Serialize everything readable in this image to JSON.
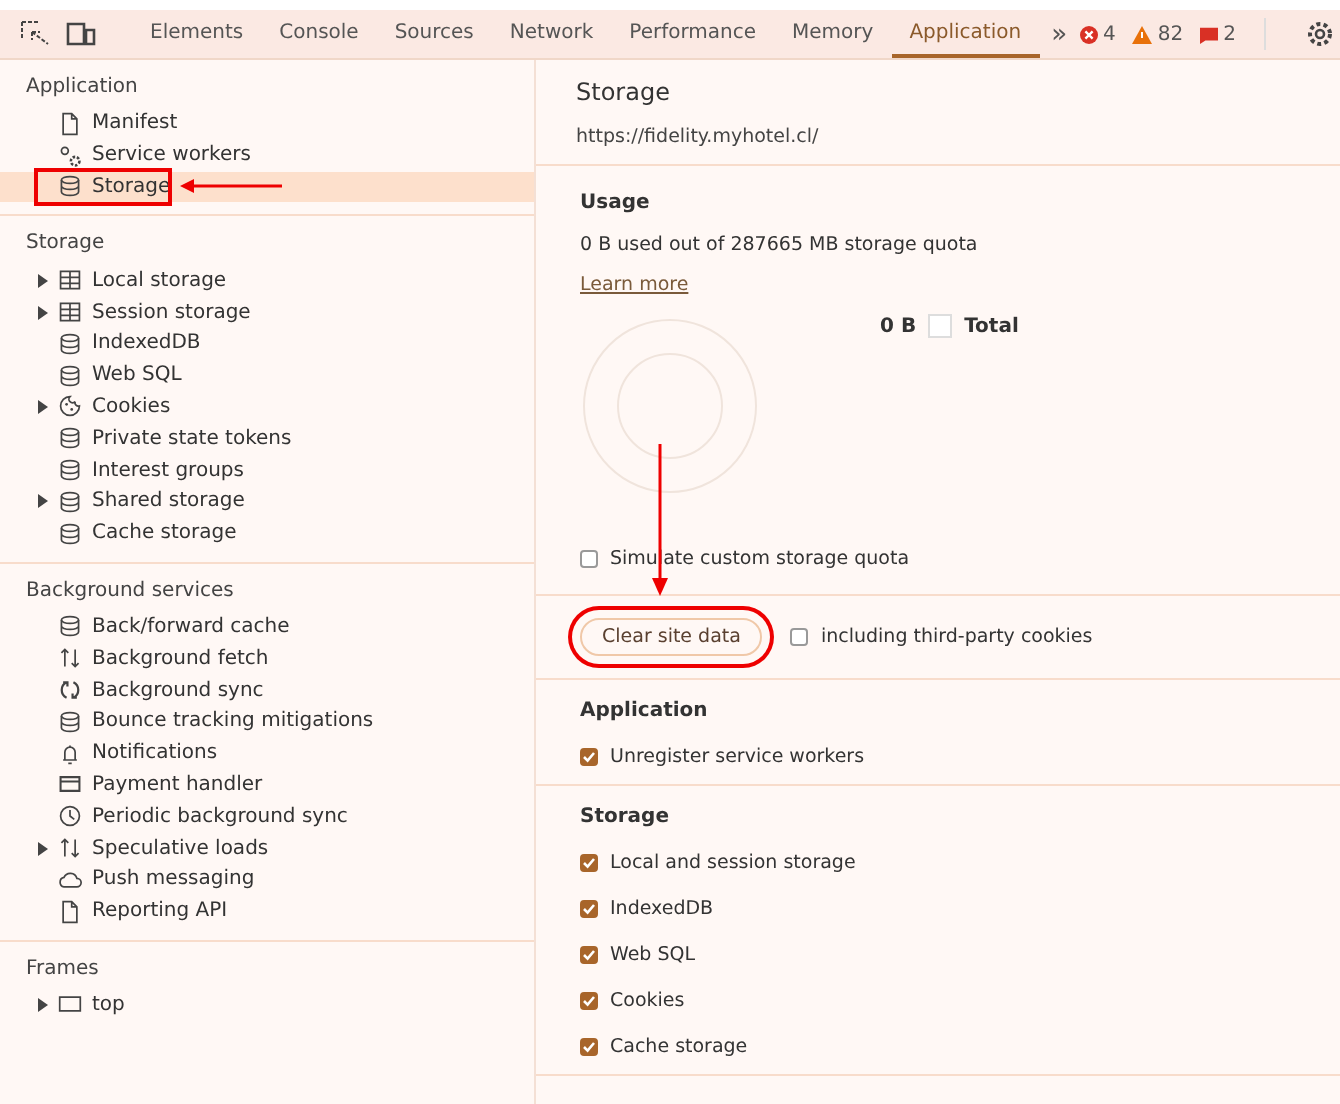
{
  "toolbar": {
    "tabs": [
      {
        "label": "Elements",
        "selected": false
      },
      {
        "label": "Console",
        "selected": false
      },
      {
        "label": "Sources",
        "selected": false
      },
      {
        "label": "Network",
        "selected": false
      },
      {
        "label": "Performance",
        "selected": false
      },
      {
        "label": "Memory",
        "selected": false
      },
      {
        "label": "Application",
        "selected": true
      }
    ],
    "more": "»",
    "counters": [
      {
        "kind": "error",
        "count": "4"
      },
      {
        "kind": "warning",
        "count": "82"
      },
      {
        "kind": "issue",
        "count": "2"
      }
    ]
  },
  "sidebar": {
    "sections": [
      {
        "title": "Application",
        "items": [
          {
            "label": "Manifest",
            "kind": "page",
            "selected": false,
            "highlighted": false
          },
          {
            "label": "Service workers",
            "kind": "gears",
            "selected": false,
            "highlighted": false
          },
          {
            "label": "Storage",
            "kind": "database",
            "selected": true,
            "highlighted": true
          }
        ]
      },
      {
        "title": "Storage",
        "items": [
          {
            "label": "Local storage",
            "kind": "table",
            "expanded": false,
            "selected": false,
            "highlighted": false
          },
          {
            "label": "Session storage",
            "kind": "table",
            "expanded": false,
            "selected": false,
            "highlighted": false
          },
          {
            "label": "IndexedDB",
            "kind": "database",
            "selected": false,
            "highlighted": false
          },
          {
            "label": "Web SQL",
            "kind": "database",
            "selected": false,
            "highlighted": false
          },
          {
            "label": "Cookies",
            "kind": "cookie",
            "expanded": false,
            "selected": false,
            "highlighted": false
          },
          {
            "label": "Private state tokens",
            "kind": "database",
            "selected": false,
            "highlighted": false
          },
          {
            "label": "Interest groups",
            "kind": "database",
            "selected": false,
            "highlighted": false
          },
          {
            "label": "Shared storage",
            "kind": "database",
            "expanded": false,
            "selected": false,
            "highlighted": false
          },
          {
            "label": "Cache storage",
            "kind": "database",
            "selected": false,
            "highlighted": false
          }
        ]
      },
      {
        "title": "Background services",
        "items": [
          {
            "label": "Back/forward cache",
            "kind": "database",
            "selected": false,
            "highlighted": false
          },
          {
            "label": "Background fetch",
            "kind": "updown",
            "selected": false,
            "highlighted": false
          },
          {
            "label": "Background sync",
            "kind": "sync",
            "selected": false,
            "highlighted": false
          },
          {
            "label": "Bounce tracking mitigations",
            "kind": "database",
            "selected": false,
            "highlighted": false
          },
          {
            "label": "Notifications",
            "kind": "bell",
            "selected": false,
            "highlighted": false
          },
          {
            "label": "Payment handler",
            "kind": "card",
            "selected": false,
            "highlighted": false
          },
          {
            "label": "Periodic background sync",
            "kind": "clock",
            "selected": false,
            "highlighted": false
          },
          {
            "label": "Speculative loads",
            "kind": "updown",
            "expanded": false,
            "selected": false,
            "highlighted": false
          },
          {
            "label": "Push messaging",
            "kind": "cloud",
            "selected": false,
            "highlighted": false
          },
          {
            "label": "Reporting API",
            "kind": "page",
            "selected": false,
            "highlighted": false
          }
        ]
      },
      {
        "title": "Frames",
        "items": [
          {
            "label": "top",
            "kind": "frame",
            "expanded": false,
            "selected": false,
            "highlighted": false
          }
        ]
      }
    ]
  },
  "main": {
    "title": "Storage",
    "origin": "https://fidelity.myhotel.cl/",
    "usage": {
      "heading": "Usage",
      "summary": "0 B used out of 287665 MB storage quota",
      "link": "Learn more",
      "legend_value": "0 B",
      "legend_label": "Total",
      "simulate": {
        "label": "Simulate custom storage quota",
        "checked": false
      }
    },
    "clear": {
      "button": "Clear site data",
      "highlighted": true,
      "third_party": {
        "label": "including third-party cookies",
        "checked": false
      }
    },
    "groups": [
      {
        "heading": "Application",
        "options": [
          {
            "label": "Unregister service workers",
            "checked": true
          }
        ]
      },
      {
        "heading": "Storage",
        "options": [
          {
            "label": "Local and session storage",
            "checked": true
          },
          {
            "label": "IndexedDB",
            "checked": true
          },
          {
            "label": "Web SQL",
            "checked": true
          },
          {
            "label": "Cookies",
            "checked": true
          },
          {
            "label": "Cache storage",
            "checked": true
          }
        ]
      }
    ]
  }
}
